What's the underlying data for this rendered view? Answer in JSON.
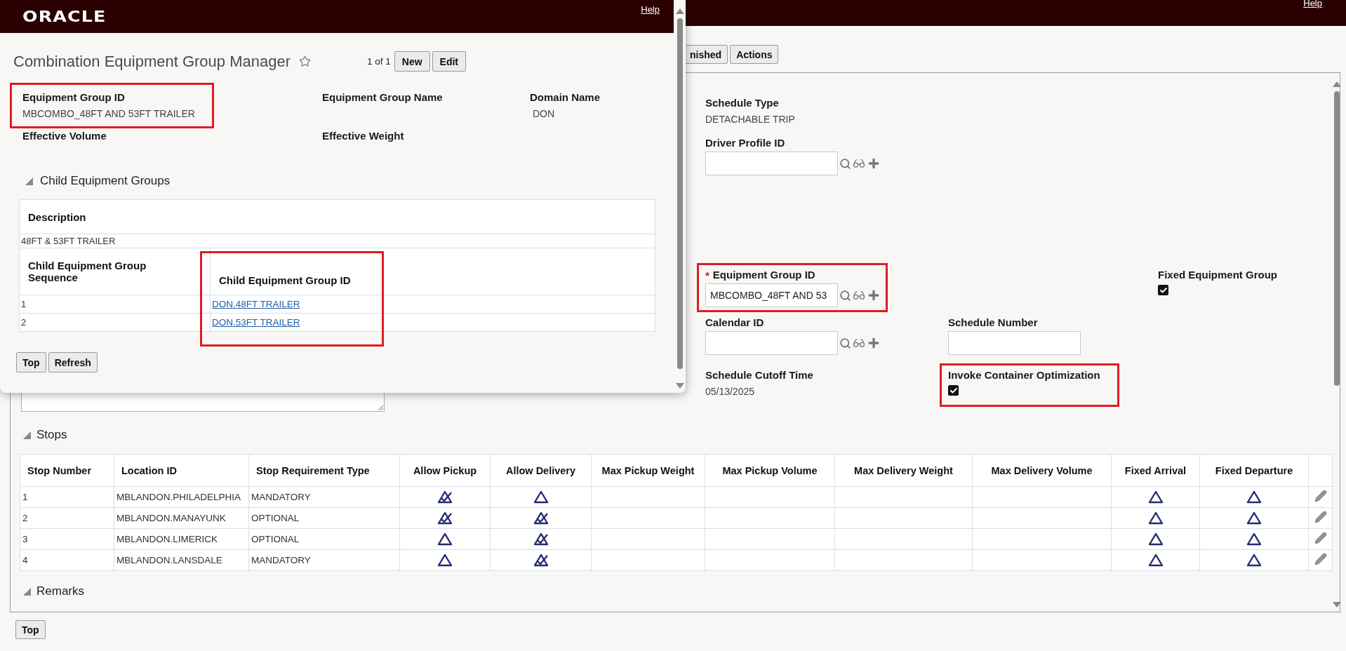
{
  "header": {
    "help": "Help"
  },
  "toolbar": {
    "buttons": [
      "nished",
      "Actions"
    ]
  },
  "form": {
    "schedule_type": {
      "label": "Schedule Type",
      "value": "DETACHABLE TRIP"
    },
    "driver_profile_id": {
      "label": "Driver Profile ID"
    },
    "equipment_group_id": {
      "label": "Equipment Group ID",
      "required_mark": "*",
      "value": "MBCOMBO_48FT AND 53",
      "highlighted": true
    },
    "fixed_equipment_group": {
      "label": "Fixed Equipment Group",
      "checked": true
    },
    "calendar_id": {
      "label": "Calendar ID"
    },
    "schedule_number": {
      "label": "Schedule Number"
    },
    "schedule_cutoff_time": {
      "label": "Schedule Cutoff Time",
      "value": "05/13/2025"
    },
    "invoke_container_optimization": {
      "label": "Invoke Container Optimization",
      "checked": true,
      "highlighted": true
    }
  },
  "stops": {
    "title": "Stops",
    "columns": [
      "Stop Number",
      "Location ID",
      "Stop Requirement Type",
      "Allow Pickup",
      "Allow Delivery",
      "Max Pickup Weight",
      "Max Pickup Volume",
      "Max Delivery Weight",
      "Max Delivery Volume",
      "Fixed Arrival",
      "Fixed Departure"
    ],
    "rows": [
      {
        "stop_number": "1",
        "location_id": "MBLANDON.PHILADELPHIA",
        "requirement": "MANDATORY",
        "allow_pickup": true,
        "allow_delivery": false,
        "fixed_arrival": false,
        "fixed_departure": false
      },
      {
        "stop_number": "2",
        "location_id": "MBLANDON.MANAYUNK",
        "requirement": "OPTIONAL",
        "allow_pickup": true,
        "allow_delivery": true,
        "fixed_arrival": false,
        "fixed_departure": false
      },
      {
        "stop_number": "3",
        "location_id": "MBLANDON.LIMERICK",
        "requirement": "OPTIONAL",
        "allow_pickup": false,
        "allow_delivery": true,
        "fixed_arrival": false,
        "fixed_departure": false
      },
      {
        "stop_number": "4",
        "location_id": "MBLANDON.LANSDALE",
        "requirement": "MANDATORY",
        "allow_pickup": false,
        "allow_delivery": true,
        "fixed_arrival": false,
        "fixed_departure": false
      }
    ]
  },
  "remarks": {
    "title": "Remarks"
  },
  "bottom_button": "Top",
  "popup": {
    "logo": "ORACLE",
    "help": "Help",
    "title": "Combination Equipment Group Manager",
    "pager": "1 of 1",
    "buttons": [
      "New",
      "Edit"
    ],
    "fields": {
      "equipment_group_id": {
        "label": "Equipment Group ID",
        "value": "MBCOMBO_48FT AND 53FT TRAILER",
        "highlighted": true
      },
      "equipment_group_name": {
        "label": "Equipment Group Name"
      },
      "domain_name": {
        "label": "Domain Name",
        "value": "DON"
      },
      "effective_volume": {
        "label": "Effective Volume"
      },
      "effective_weight": {
        "label": "Effective Weight"
      }
    },
    "section": {
      "title": "Child Equipment Groups",
      "description_header": "Description",
      "description": "48FT & 53FT TRAILER",
      "columns": [
        {
          "label": "Child Equipment Group Sequence",
          "highlighted": false
        },
        {
          "label": "Child Equipment Group ID",
          "highlighted": true
        }
      ],
      "rows": [
        {
          "sequence": "1",
          "id": "DON.48FT TRAILER"
        },
        {
          "sequence": "2",
          "id": "DON.53FT TRAILER"
        }
      ]
    },
    "footer_buttons": [
      "Top",
      "Refresh"
    ]
  }
}
